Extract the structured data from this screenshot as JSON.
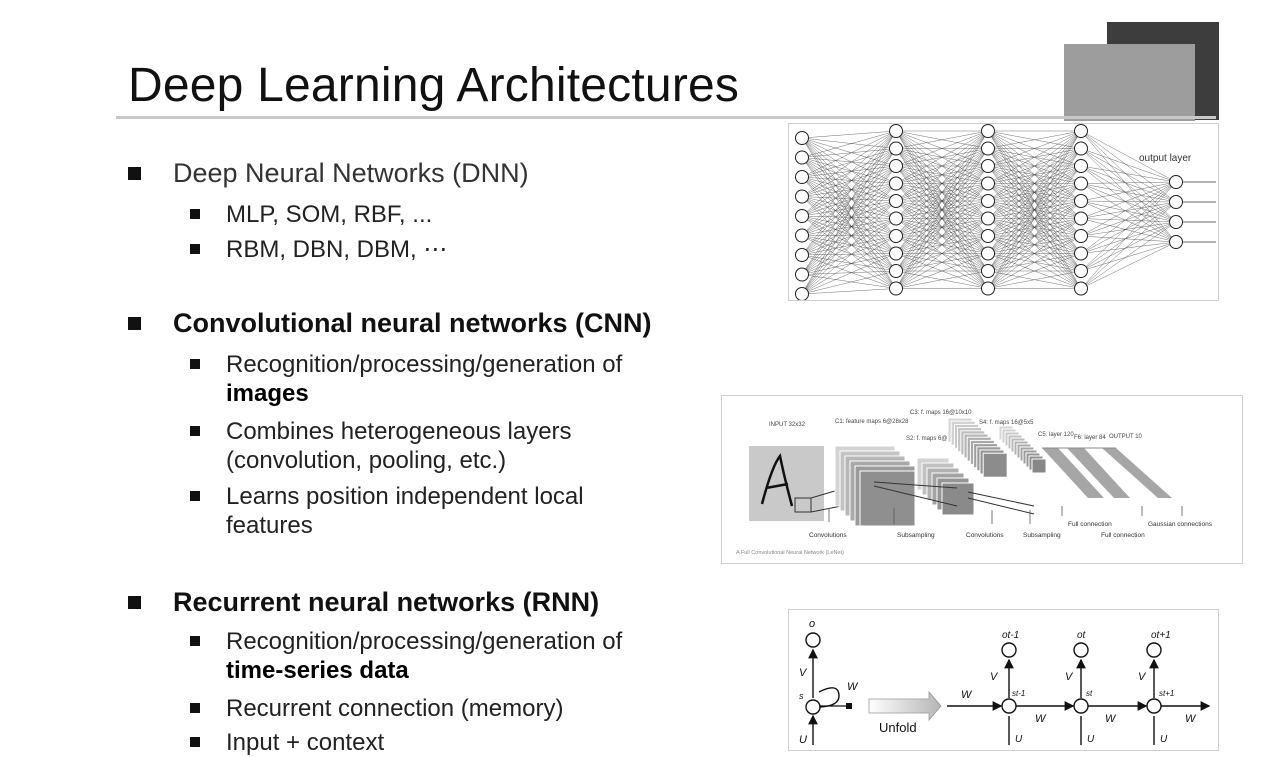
{
  "slide": {
    "title": "Deep Learning Architectures"
  },
  "dnn": {
    "heading": "Deep Neural Networks (DNN)",
    "items": [
      "MLP, SOM, RBF, ...",
      "RBM, DBN, DBM, ⋯"
    ],
    "figure_label": "output layer"
  },
  "cnn": {
    "heading": "Convolutional neural networks (CNN)",
    "items": [
      {
        "line1": "Recognition/processing/generation of",
        "line2": "images"
      },
      {
        "line1": "Combines heterogeneous layers",
        "line2": "(convolution, pooling, etc.)"
      },
      {
        "line1": "Learns position independent local",
        "line2": "features"
      }
    ],
    "figure": {
      "input": "INPUT 32x32",
      "c1": "C1: feature maps 6@28x28",
      "s2": "S2: f. maps 6@14x14",
      "c3": "C3: f. maps 16@10x10",
      "s4": "S4: f. maps 16@5x5",
      "c5": "C5: layer 120",
      "f6": "F6: layer 84",
      "output": "OUTPUT 10",
      "b_conv1": "Convolutions",
      "b_sub1": "Subsampling",
      "b_conv2": "Convolutions",
      "b_sub2": "Subsampling",
      "b_full1": "Full connection",
      "b_full2": "Full connection",
      "b_gauss": "Gaussian connections",
      "caption": "A Full Convolutional Neural Network (LeNet)"
    }
  },
  "rnn": {
    "heading": "Recurrent neural networks (RNN)",
    "items": [
      {
        "line1": "Recognition/processing/generation of",
        "line2": "time-series data"
      },
      {
        "line1": "Recurrent connection (memory)"
      },
      {
        "line1": "Input + context"
      }
    ],
    "figure": {
      "unfold": "Unfold",
      "o": "o",
      "o_prev": "ot-1",
      "o_t": "ot",
      "o_next": "ot+1",
      "s": "s",
      "s_prev": "st-1",
      "s_t": "st",
      "s_next": "st+1",
      "v": "V",
      "w": "W",
      "u": "U"
    }
  }
}
